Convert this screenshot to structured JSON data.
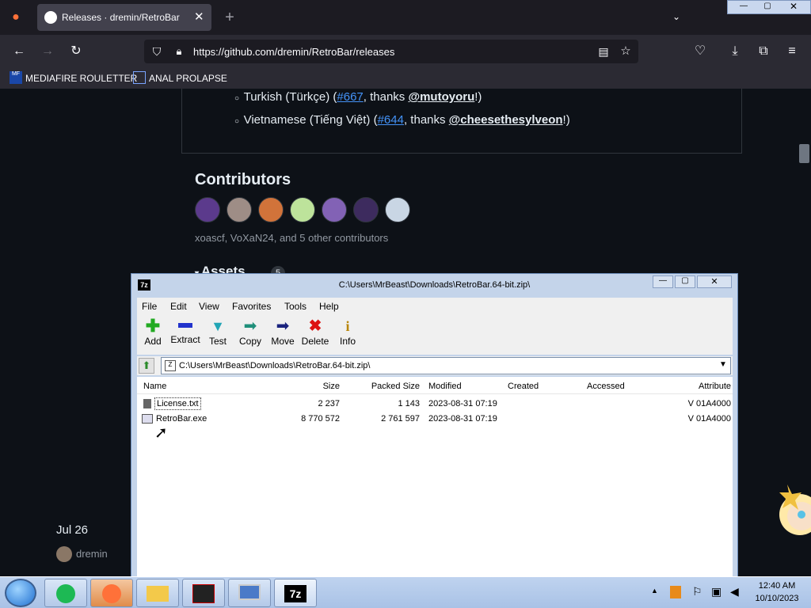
{
  "browser": {
    "tab_title": "Releases · dremin/RetroBar",
    "url": "https://github.com/dremin/RetroBar/releases",
    "bookmarks": [
      {
        "label": "MEDIAFIRE ROULETTER"
      },
      {
        "label": "ANAL PROLAPSE"
      }
    ]
  },
  "page": {
    "translations": [
      {
        "pre": "Turkish (Türkçe) (",
        "link": "#667",
        "mid": ", thanks ",
        "user": "@mutoyoru",
        "post": "!)"
      },
      {
        "pre": "Vietnamese (Tiếng Việt) (",
        "link": "#644",
        "mid": ", thanks ",
        "user": "@cheesethesylveon",
        "post": "!)"
      }
    ],
    "contributors_title": "Contributors",
    "contributors_text": "xoascf, VoXaN24, and 5 other contributors",
    "assets_label": "Assets",
    "assets_count": "5",
    "date": "Jul 26",
    "author": "dremin"
  },
  "zip": {
    "title": "C:\\Users\\MrBeast\\Downloads\\RetroBar.64-bit.zip\\",
    "menu": [
      "File",
      "Edit",
      "View",
      "Favorites",
      "Tools",
      "Help"
    ],
    "toolbar": [
      {
        "label": "Add",
        "icon": "add-icon",
        "color": "#22aa22"
      },
      {
        "label": "Extract",
        "icon": "extract-icon",
        "color": "#2233cc"
      },
      {
        "label": "Test",
        "icon": "test-icon",
        "color": "#22a5b5"
      },
      {
        "label": "Copy",
        "icon": "copy-icon",
        "color": "#1f8f7a"
      },
      {
        "label": "Move",
        "icon": "move-icon",
        "color": "#1a237e"
      },
      {
        "label": "Delete",
        "icon": "delete-icon",
        "color": "#dd1111"
      },
      {
        "label": "Info",
        "icon": "info-icon",
        "color": "#b8860b"
      }
    ],
    "path": "C:\\Users\\MrBeast\\Downloads\\RetroBar.64-bit.zip\\",
    "columns": [
      "Name",
      "Size",
      "Packed Size",
      "Modified",
      "Created",
      "Accessed",
      "Attribute"
    ],
    "files": [
      {
        "name": "License.txt",
        "size": "2 237",
        "packed": "1 143",
        "modified": "2023-08-31 07:19",
        "attr": "V 01A4000"
      },
      {
        "name": "RetroBar.exe",
        "size": "8 770 572",
        "packed": "2 761 597",
        "modified": "2023-08-31 07:19",
        "attr": "V 01A4000"
      }
    ]
  },
  "taskbar": {
    "time": "12:40 AM",
    "date": "10/10/2023"
  }
}
